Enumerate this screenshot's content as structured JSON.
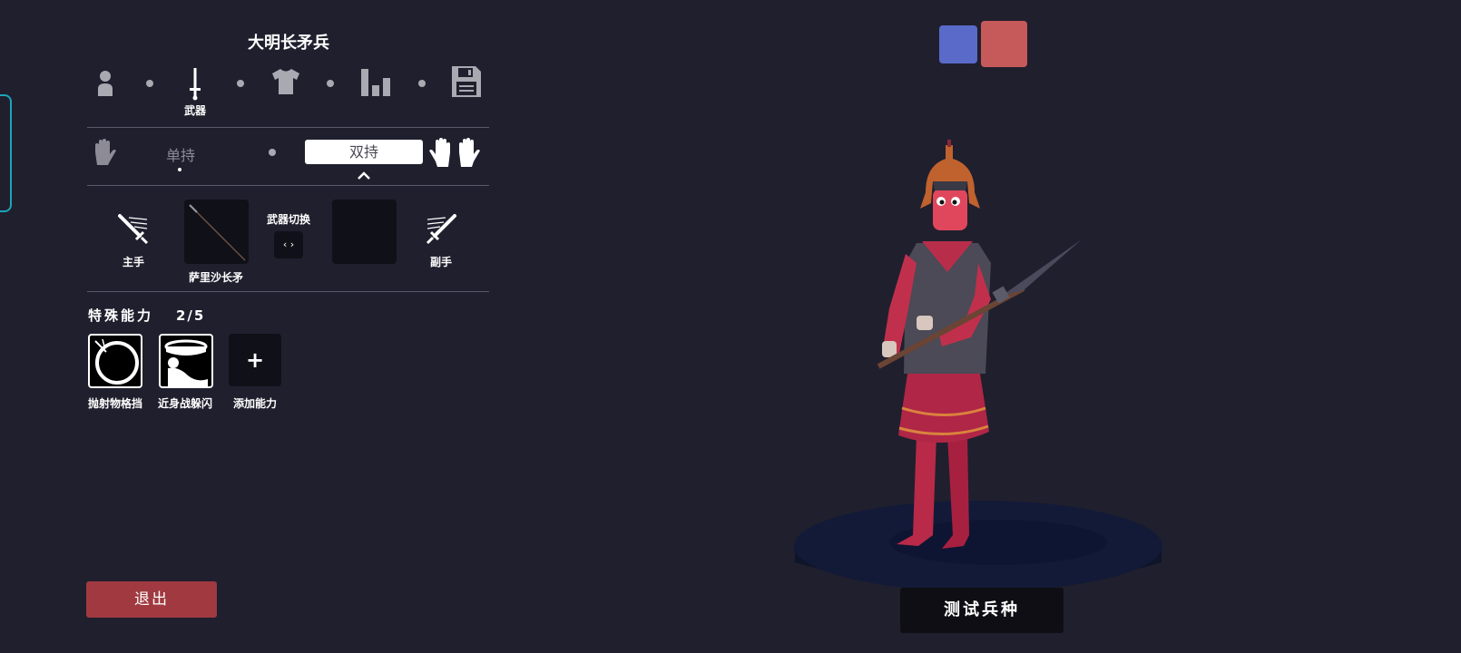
{
  "unit_name": "大明长矛兵",
  "tabs": [
    {
      "icon": "person-icon",
      "label": ""
    },
    {
      "icon": "sword-icon",
      "label": "武器"
    },
    {
      "icon": "shirt-icon",
      "label": ""
    },
    {
      "icon": "stats-bars-icon",
      "label": ""
    },
    {
      "icon": "save-disk-icon",
      "label": ""
    }
  ],
  "hold": {
    "single_label": "单持",
    "dual_label": "双持",
    "selected": "双持"
  },
  "weapons": {
    "main_hand_label": "主手",
    "main_weapon_name": "萨里沙长矛",
    "switch_label": "武器切换",
    "switch_button": "‹ ›",
    "off_hand_label": "副手"
  },
  "abilities": {
    "heading": "特殊能力",
    "count": "2/5",
    "items": [
      {
        "label": "抛射物格挡",
        "icon": "projectile-block-icon"
      },
      {
        "label": "近身战躲闪",
        "icon": "melee-dodge-icon"
      },
      {
        "label": "添加能力",
        "icon": "plus-icon",
        "symbol": "+"
      }
    ]
  },
  "team_colors": {
    "blue": "#5a6ac8",
    "red": "#c65a5a"
  },
  "buttons": {
    "exit": "退出",
    "test": "测试兵种"
  },
  "colors": {
    "background": "#201f2e",
    "exit_button": "#a03a40",
    "edge_tab": "#1aa6b8"
  }
}
